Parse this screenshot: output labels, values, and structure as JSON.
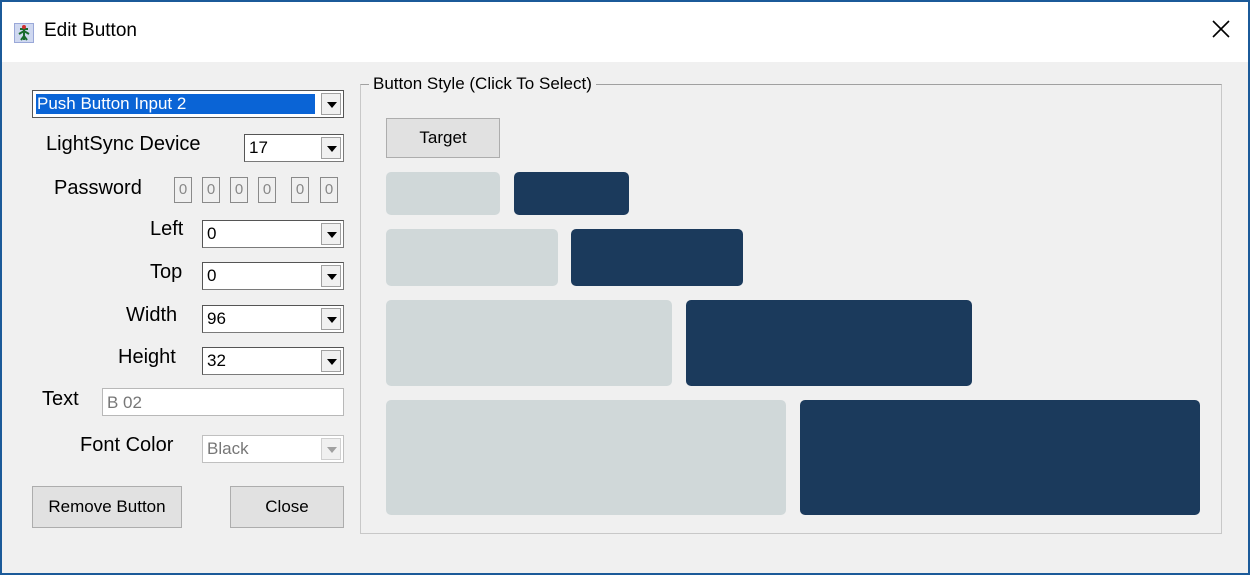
{
  "window": {
    "title": "Edit Button"
  },
  "form": {
    "input_select": {
      "value": "Push Button Input 2"
    },
    "device": {
      "label": "LightSync Device",
      "value": "17"
    },
    "password": {
      "label": "Password",
      "digits": [
        "0",
        "0",
        "0",
        "0",
        "0",
        "0"
      ]
    },
    "left": {
      "label": "Left",
      "value": "0"
    },
    "top": {
      "label": "Top",
      "value": "0"
    },
    "width": {
      "label": "Width",
      "value": "96"
    },
    "height": {
      "label": "Height",
      "value": "32"
    },
    "text": {
      "label": "Text",
      "value": "B 02"
    },
    "font_color": {
      "label": "Font Color",
      "value": "Black"
    },
    "remove_label": "Remove Button",
    "close_label": "Close"
  },
  "style_group": {
    "legend": "Button Style (Click To Select)",
    "target_label": "Target"
  },
  "colors": {
    "style_light": "#d0d8d9",
    "style_dark": "#1b3a5c",
    "window_border": "#1b5a99"
  },
  "icons": {
    "app": "app-icon",
    "close": "close-icon"
  }
}
